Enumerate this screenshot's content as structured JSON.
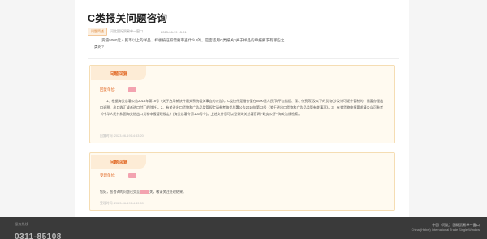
{
  "header": {
    "title": "C类报关问题咨询",
    "tag": "问题简述",
    "org": "河北国际贸易单一窗口",
    "date": "2023-06-19 15:01"
  },
  "question": "货值5000元人民币以上的样品、样板按证照需要审查什么?的，是否适用C类报关?关于样品的申报要求有哪些之类的?",
  "replies": [
    {
      "pill": "问题回复",
      "unit_label": "回复单位:",
      "text": "1、根据海关总署公告2016年第18号《关于启用新快件通关系统相关事宜的公告》，C类快件是指价值在5000元人民币(不包括运、保、杂费等)及以下的货物(涉及许可证件管制的，需要办理出口退税、出口收汇或者进口付汇的除外)。2、有关进出口货物和广告品监管规定请参考海关总署公告2010年第33号《关于进出口货物和广告品监管有关事项》。3、有关货物申报要求请公众可参考《中华人民共和国海关进出口货物申报管理规定》(海关总署令第103号令)。上述文件您可以登录海关总署官网--政务公开--海关法规检索。",
      "time": "回复时间: 2023-06-19 14:53:20"
    },
    {
      "pill": "问题回复",
      "unit_label": "受理单位:",
      "text_a": "您好，您咨询的问题已交至",
      "text_b": "关，敬请关注处理结果。",
      "time": "受理时间: 2023-06-19 14:49:59"
    }
  ],
  "footer": {
    "label": "服务热线",
    "phone": "0311-85108",
    "brand_cn": "中国（河北）国际贸易单一窗口",
    "brand_en": "China (Hebei) International Trade Single Window"
  }
}
